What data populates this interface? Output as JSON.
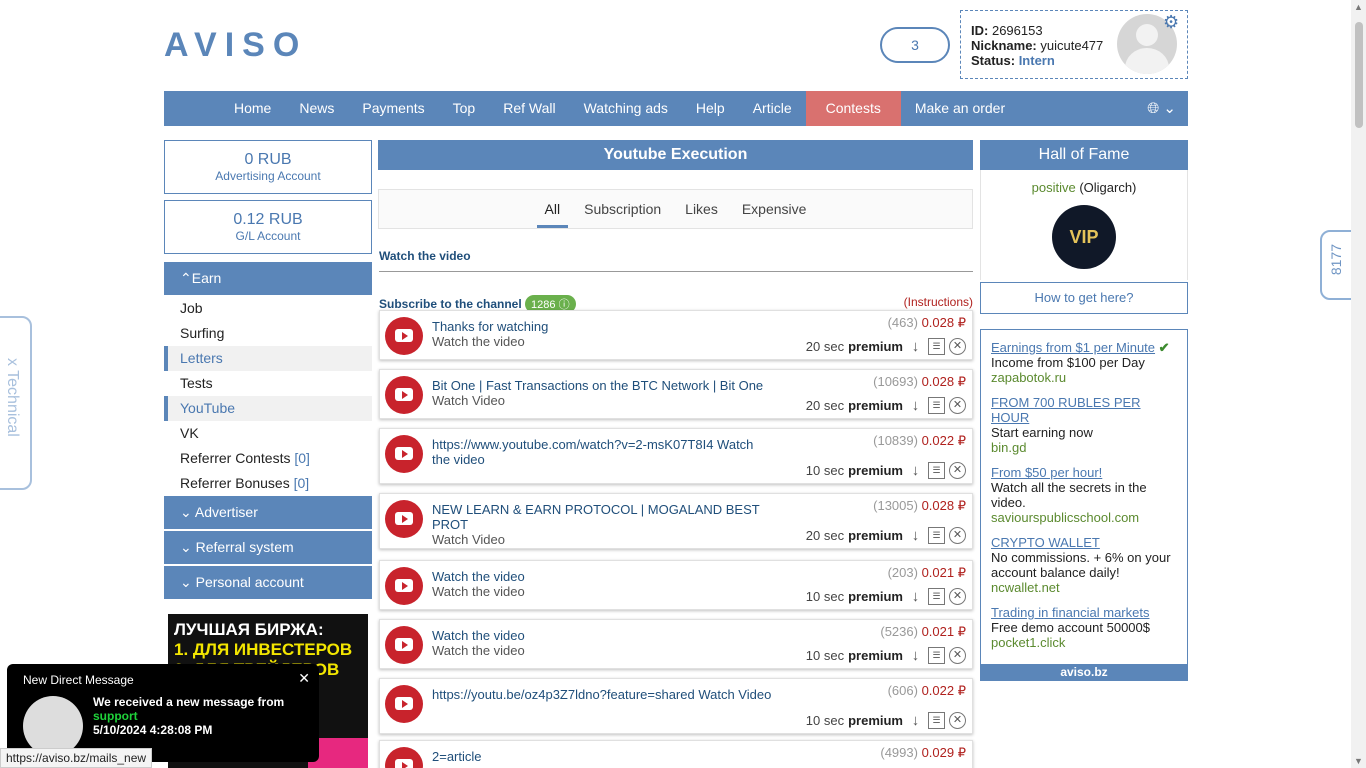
{
  "header": {
    "logo": "AVISO",
    "messages_count": "3",
    "user": {
      "id_label": "ID:",
      "id": "2696153",
      "nick_label": "Nickname:",
      "nick": "yuicute477",
      "status_label": "Status:",
      "status": "Intern"
    }
  },
  "nav": [
    "Home",
    "News",
    "Payments",
    "Top",
    "Ref Wall",
    "Watching ads",
    "Help",
    "Article",
    "Contests",
    "Make an order"
  ],
  "accounts": [
    {
      "amount": "0 RUB",
      "label": "Advertising Account"
    },
    {
      "amount": "0.12 RUB",
      "label": "G/L Account"
    }
  ],
  "sidebar": {
    "earn": "Earn",
    "items": [
      "Job",
      "Surfing",
      "Letters",
      "Tests",
      "YouTube",
      "VK"
    ],
    "referrer_contests": "Referrer Contests",
    "referrer_contests_cnt": "[0]",
    "referrer_bonuses": "Referrer Bonuses",
    "referrer_bonuses_cnt": "[0]",
    "advertiser": "Advertiser",
    "referral": "Referral system",
    "personal": "Personal account"
  },
  "banner": {
    "l1": "ЛУЧШАЯ БИРЖА:",
    "l2": "1. ДЛЯ ИНВЕСТЕРОВ",
    "l3": "2. ДЛЯ ТРЕЙДЕРОВ"
  },
  "main": {
    "title": "Youtube Execution",
    "tabs": [
      "All",
      "Subscription",
      "Likes",
      "Expensive"
    ],
    "watch_link": "Watch the video",
    "subscribe": "Subscribe to the channel",
    "subscribe_count": "1286",
    "instructions": "(Instructions)",
    "premium": "premium",
    "tasks": [
      {
        "title": "Thanks for watching",
        "sub": "Watch the video",
        "count": "(463)",
        "price": "0.028 ₽",
        "time": "20 sec"
      },
      {
        "title": "Bit One | Fast Transactions on the BTC Network | Bit One",
        "sub": "Watch Video",
        "count": "(10693)",
        "price": "0.028 ₽",
        "time": "20 sec"
      },
      {
        "title": "https://www.youtube.com/watch?v=2-msK07T8I4 Watch the video",
        "sub": "",
        "count": "(10839)",
        "price": "0.022 ₽",
        "time": "10 sec"
      },
      {
        "title": "NEW LEARN & EARN PROTOCOL | MOGALAND BEST PROT",
        "sub": "Watch Video",
        "count": "(13005)",
        "price": "0.028 ₽",
        "time": "20 sec"
      },
      {
        "title": "Watch the video",
        "sub": "Watch the video",
        "count": "(203)",
        "price": "0.021 ₽",
        "time": "10 sec"
      },
      {
        "title": "Watch the video",
        "sub": "Watch the video",
        "count": "(5236)",
        "price": "0.021 ₽",
        "time": "10 sec"
      },
      {
        "title": "https://youtu.be/oz4p3Z7ldno?feature=shared Watch Video",
        "sub": "",
        "count": "(606)",
        "price": "0.022 ₽",
        "time": "10 sec"
      },
      {
        "title": "2=article",
        "sub": "",
        "count": "(4993)",
        "price": "0.029 ₽",
        "time": ""
      }
    ]
  },
  "hof": {
    "title": "Hall of Fame",
    "name": "positive",
    "rank": "(Oligarch)",
    "how": "How to get here?",
    "vip": "VIP"
  },
  "ads": [
    {
      "title": "Earnings from $1 per Minute",
      "desc": "Income from $100 per Day",
      "site": "zapabotok.ru"
    },
    {
      "title": "FROM 700 RUBLES PER HOUR",
      "desc": "Start earning now",
      "site": "bin.gd"
    },
    {
      "title": "From $50 per hour!",
      "desc": "Watch all the secrets in the video.",
      "site": "saviourspublicschool.com"
    },
    {
      "title": "CRYPTO WALLET",
      "desc": "No commissions. + 6% on your account balance daily!",
      "site": "ncwallet.net"
    },
    {
      "title": "Trading in financial markets",
      "desc": "Free demo account 50000$",
      "site": "pocket1.click"
    }
  ],
  "ads_footer": "aviso.bz",
  "tech_tab": "x Technical",
  "right_tab": "8177",
  "notification": {
    "title": "New Direct Message",
    "line1": "We received a new message from",
    "from": "support",
    "time": "5/10/2024 4:28:08 PM"
  },
  "status_url": "https://aviso.bz/mails_new"
}
